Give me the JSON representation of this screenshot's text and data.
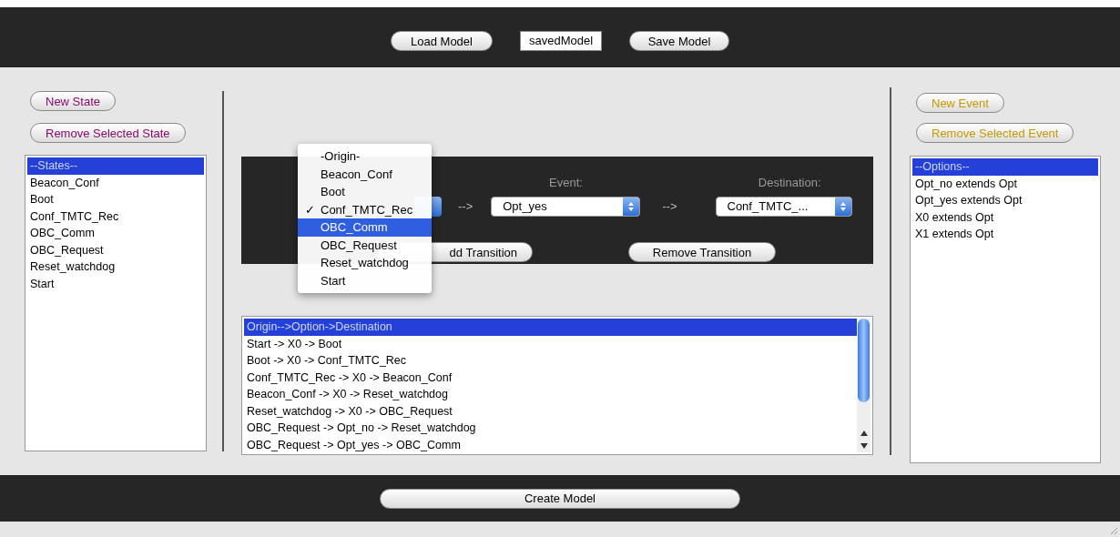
{
  "top_bar": {
    "load_button": "Load Model",
    "model_name": "savedModel",
    "save_button": "Save Model"
  },
  "states_panel": {
    "new_button": "New State",
    "remove_button": "Remove Selected State",
    "items": [
      {
        "label": "--States--",
        "selected": true
      },
      {
        "label": "Beacon_Conf",
        "selected": false
      },
      {
        "label": "Boot",
        "selected": false
      },
      {
        "label": "Conf_TMTC_Rec",
        "selected": false
      },
      {
        "label": "OBC_Comm",
        "selected": false
      },
      {
        "label": "OBC_Request",
        "selected": false
      },
      {
        "label": "Reset_watchdog",
        "selected": false
      },
      {
        "label": "Start",
        "selected": false
      }
    ]
  },
  "transition_editor": {
    "event_label": "Event:",
    "destination_label": "Destination:",
    "arrow_1": "-->",
    "arrow_2": "-->",
    "event_value": "Opt_yes",
    "destination_value": "Conf_TMTC_...",
    "add_button": "dd Transition",
    "remove_button": "Remove Transition",
    "origin_menu": [
      {
        "label": "-Origin-",
        "checked": false,
        "selected": false
      },
      {
        "label": "Beacon_Conf",
        "checked": false,
        "selected": false
      },
      {
        "label": "Boot",
        "checked": false,
        "selected": false
      },
      {
        "label": "Conf_TMTC_Rec",
        "checked": true,
        "selected": false
      },
      {
        "label": "OBC_Comm",
        "checked": false,
        "selected": true
      },
      {
        "label": "OBC_Request",
        "checked": false,
        "selected": false
      },
      {
        "label": "Reset_watchdog",
        "checked": false,
        "selected": false
      },
      {
        "label": "Start",
        "checked": false,
        "selected": false
      }
    ],
    "check_mark": "✓"
  },
  "transitions": [
    {
      "label": "Origin-->Option->Destination",
      "selected": true
    },
    {
      "label": "Start -> X0 -> Boot",
      "selected": false
    },
    {
      "label": "Boot -> X0 -> Conf_TMTC_Rec",
      "selected": false
    },
    {
      "label": "Conf_TMTC_Rec -> X0 -> Beacon_Conf",
      "selected": false
    },
    {
      "label": "Beacon_Conf -> X0 -> Reset_watchdog",
      "selected": false
    },
    {
      "label": "Reset_watchdog -> X0 -> OBC_Request",
      "selected": false
    },
    {
      "label": "OBC_Request -> Opt_no -> Reset_watchdog",
      "selected": false
    },
    {
      "label": "OBC_Request -> Opt_yes -> OBC_Comm",
      "selected": false
    }
  ],
  "events_panel": {
    "new_button": "New Event",
    "remove_button": "Remove Selected Event",
    "items": [
      {
        "label": "--Options--",
        "selected": true
      },
      {
        "label": "Opt_no extends Opt",
        "selected": false
      },
      {
        "label": "Opt_yes extends Opt",
        "selected": false
      },
      {
        "label": "X0 extends Opt",
        "selected": false
      },
      {
        "label": "X1 extends Opt",
        "selected": false
      }
    ]
  },
  "bottom_bar": {
    "create_button": "Create Model"
  }
}
